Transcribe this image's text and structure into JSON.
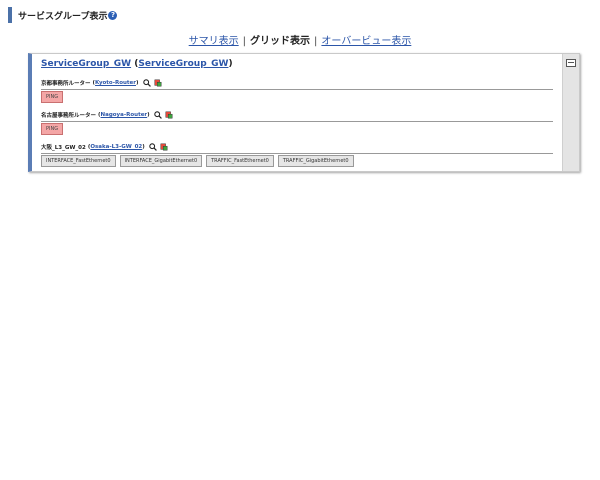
{
  "header": {
    "title": "サービスグループ表示",
    "help": "?"
  },
  "tabs": {
    "summary": "サマリ表示",
    "grid": "グリッド表示",
    "overview": "オーバービュー表示",
    "separator": "|"
  },
  "group": {
    "name": "ServiceGroup_GW",
    "alias": "ServiceGroup_GW",
    "paren_open": "(",
    "paren_close": ")"
  },
  "hosts": [
    {
      "label": "京都事務所ルーター",
      "name": "Kyoto-Router",
      "services": [
        {
          "label": "PING",
          "status": "critical"
        }
      ]
    },
    {
      "label": "名古屋事務所ルーター",
      "name": "Nagoya-Router",
      "services": [
        {
          "label": "PING",
          "status": "critical"
        }
      ]
    },
    {
      "label": "大阪_L3_GW_02",
      "name": "Osaka-L3-GW_02",
      "services": [
        {
          "label": "INTERFACE_FastEthernet0",
          "status": "ok"
        },
        {
          "label": "INTERFACE_GigabitEthernet0",
          "status": "ok"
        },
        {
          "label": "TRAFFIC_FastEthernet0",
          "status": "ok"
        },
        {
          "label": "TRAFFIC_GigabitEthernet0",
          "status": "ok"
        }
      ]
    }
  ],
  "colors": {
    "accent": "#4b71a8",
    "link": "#2b55a8",
    "critical": "#f4a6a6",
    "ok": "#e6e6e6"
  },
  "icons": {
    "help": "help-icon",
    "search": "search-icon",
    "graph": "graph-icon",
    "collapse": "collapse-icon"
  }
}
